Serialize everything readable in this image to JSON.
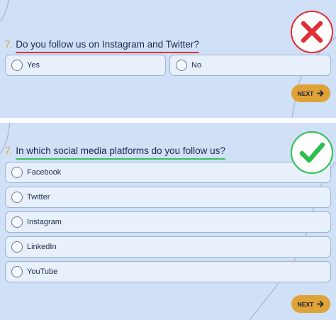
{
  "colors": {
    "panel_bg": "#cfe0f7",
    "option_bg": "#e8f0fc",
    "accent_orange": "#dfa237",
    "wrong_red": "#e02e36",
    "right_green": "#38c45a"
  },
  "panel1": {
    "question_number": "7.",
    "question": "Do you follow us on Instagram and Twitter?",
    "options": [
      "Yes",
      "No"
    ],
    "next_label": "NEXT",
    "badge_icon": "cross-mark-icon"
  },
  "panel2": {
    "question_number": "7.",
    "question": "In which social media platforms do you follow us?",
    "options": [
      "Facebook",
      "Twitter",
      "Instagram",
      "LinkedIn",
      "YouTube"
    ],
    "next_label": "NEXT",
    "badge_icon": "check-mark-icon"
  }
}
